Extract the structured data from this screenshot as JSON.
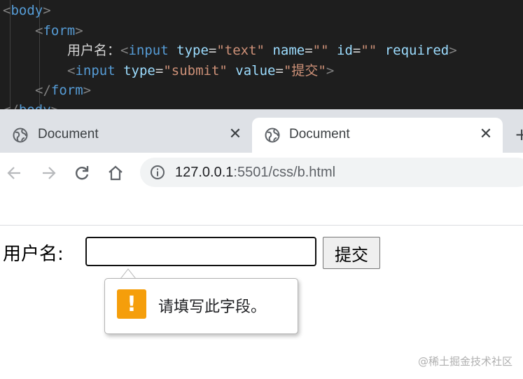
{
  "editor": {
    "line1": {
      "open": "<",
      "tag": "body",
      "close": ">"
    },
    "line2": {
      "open": "<",
      "tag": "form",
      "close": ">"
    },
    "line3": {
      "text": "用户名：",
      "open": "<",
      "tag": "input",
      "attr1": "type",
      "eq1": "=",
      "val1": "\"text\"",
      "attr2": "name",
      "eq2": "=",
      "val2": "\"\"",
      "attr3": "id",
      "eq3": "=",
      "val3": "\"\"",
      "attr4": "required",
      "close": ">"
    },
    "line4": {
      "open": "<",
      "tag": "input",
      "attr1": "type",
      "eq1": "=",
      "val1": "\"submit\"",
      "attr2": "value",
      "eq2": "=",
      "val2": "\"提交\"",
      "close": ">"
    },
    "line5": {
      "open": "</",
      "tag": "form",
      "close": ">"
    },
    "line6": {
      "open": "</",
      "tag": "body",
      "close": ">"
    }
  },
  "browser": {
    "tabs": [
      {
        "title": "Document",
        "close": "✕"
      },
      {
        "title": "Document",
        "close": "✕"
      }
    ],
    "new_tab": "+",
    "url_host": "127.0.0.1",
    "url_rest": ":5501/css/b.html"
  },
  "form": {
    "label": "用户名:",
    "input_value": "",
    "submit_label": "提交"
  },
  "validation": {
    "icon_glyph": "!",
    "message": "请填写此字段。"
  },
  "watermark": "@稀土掘金技术社区",
  "colors": {
    "warning": "#f59e0b",
    "editor_bg": "#1e1e1e",
    "tabstrip_bg": "#dee1e6"
  }
}
